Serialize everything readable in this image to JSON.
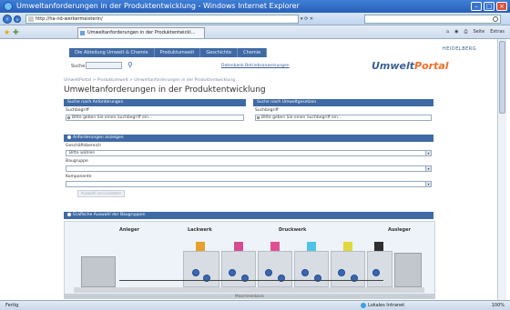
{
  "window": {
    "title": "Umweltanforderungen in der Produktentwicklung - Windows Internet Explorer"
  },
  "addressbar": {
    "url": "http://ha-nd-werkermeisterin/",
    "search_placeholder": ""
  },
  "tabbar": {
    "tab_label": "Umweltanforderungen in der Produktentwickl..."
  },
  "commandbar": {
    "page_label": "Seite",
    "extras_label": "Extras"
  },
  "site": {
    "nav": [
      "Die Abteilung Umwelt & Chemie",
      "Produktumwelt",
      "Geschichte",
      "Chemie"
    ],
    "search_label": "Suche",
    "adv_search_link": "Datenbank Betriebsanweisungen",
    "logo_main": "Umwelt",
    "logo_accent": "Portal",
    "company_logo": "HEIDELBERG",
    "breadcrumb": "UmweltPortal > Produktumwelt > Umweltanforderungen in der Produktentwicklung",
    "page_title": "Umweltanforderungen in der Produktentwicklung"
  },
  "panels": {
    "left_search": {
      "header": "Suche nach Anforderungen",
      "label": "Suchbegriff",
      "placeholder": "Bitte geben Sie einen Suchbegriff ein..."
    },
    "right_search": {
      "header": "Suche nach Umweltgesetzen",
      "label": "Suchbegriff",
      "placeholder": "Bitte geben Sie einen Suchbegriff ein..."
    },
    "filter": {
      "header": "Anforderungen anzeigen",
      "field1_label": "Geschäftsbereich",
      "field1_value": "Bitte wählen",
      "field2_label": "Baugruppe",
      "field2_value": "",
      "field3_label": "Komponente",
      "field3_value": "",
      "reset_label": "Auswahl zurücksetzen"
    },
    "diagram": {
      "header": "Grafische Auswahl der Baugruppen",
      "stages": [
        "Anleger",
        "Lackwerk",
        "Druckwerk",
        "Ausleger"
      ],
      "bottom_label": "Maschinenbasis"
    }
  },
  "statusbar": {
    "left": "Fertig",
    "zone": "Lokales Intranet",
    "zoom": "100%"
  }
}
